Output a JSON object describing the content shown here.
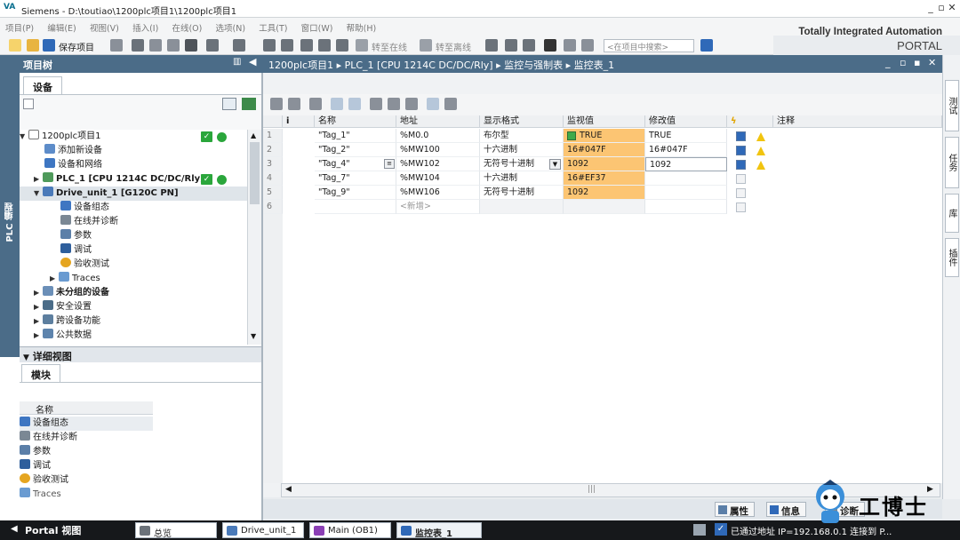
{
  "window": {
    "app": "Siemens",
    "title": "Siemens  -  D:\\toutiao\\1200plc项目1\\1200plc项目1"
  },
  "menu": [
    "项目(P)",
    "编辑(E)",
    "视图(V)",
    "插入(I)",
    "在线(O)",
    "选项(N)",
    "工具(T)",
    "窗口(W)",
    "帮助(H)"
  ],
  "brand": {
    "line1": "Totally Integrated Automation",
    "line2": "PORTAL"
  },
  "toolbar": {
    "save_label": "保存项目",
    "go_online": "转至在线",
    "go_offline": "转至离线",
    "search_placeholder": "<在项目中搜索>"
  },
  "project_tree": {
    "header": "项目树",
    "side_label": "PLC 编程",
    "devices_tab": "设备",
    "items": [
      {
        "label": "1200plc项目1",
        "bold": false
      },
      {
        "label": "添加新设备"
      },
      {
        "label": "设备和网络"
      },
      {
        "label": "PLC_1 [CPU 1214C DC/DC/Rly]"
      },
      {
        "label": "Drive_unit_1 [G120C PN]"
      },
      {
        "label": "设备组态"
      },
      {
        "label": "在线并诊断"
      },
      {
        "label": "参数"
      },
      {
        "label": "调试"
      },
      {
        "label": "验收测试"
      },
      {
        "label": "Traces"
      },
      {
        "label": "未分组的设备"
      },
      {
        "label": "安全设置"
      },
      {
        "label": "跨设备功能"
      },
      {
        "label": "公共数据"
      }
    ]
  },
  "detail_view": {
    "header": "详细视图",
    "tab": "模块",
    "column": "名称",
    "items": [
      "设备组态",
      "在线并诊断",
      "参数",
      "调试",
      "验收测试",
      "Traces"
    ]
  },
  "breadcrumb": [
    "1200plc项目1",
    "PLC_1 [CPU 1214C DC/DC/Rly]",
    "监控与强制表",
    "监控表_1"
  ],
  "watch_table": {
    "columns": [
      "i",
      "名称",
      "地址",
      "显示格式",
      "监视值",
      "修改值",
      "",
      "注释"
    ],
    "rows": [
      {
        "n": "1",
        "name": "\"Tag_1\"",
        "addr": "%M0.0",
        "fmt": "布尔型",
        "mon": "TRUE",
        "mod": "TRUE"
      },
      {
        "n": "2",
        "name": "\"Tag_2\"",
        "addr": "%MW100",
        "fmt": "十六进制",
        "mon": "16#047F",
        "mod": "16#047F"
      },
      {
        "n": "3",
        "name": "\"Tag_4\"",
        "addr": "%MW102",
        "fmt": "无符号十进制",
        "mon": "1092",
        "mod": "1092"
      },
      {
        "n": "4",
        "name": "\"Tag_7\"",
        "addr": "%MW104",
        "fmt": "十六进制",
        "mon": "16#EF37",
        "mod": ""
      },
      {
        "n": "5",
        "name": "\"Tag_9\"",
        "addr": "%MW106",
        "fmt": "无符号十进制",
        "mon": "1092",
        "mod": ""
      },
      {
        "n": "6",
        "name": "",
        "addr": "<新增>",
        "fmt": "",
        "mon": "",
        "mod": ""
      }
    ],
    "monitor_color": "#fcc573"
  },
  "inspector_tabs": [
    "属性",
    "信息",
    "诊断"
  ],
  "right_tabs": [
    "测试",
    "任务",
    "库",
    "插件"
  ],
  "taskbar": {
    "portal": "Portal 视图",
    "tabs": [
      "总览",
      "Drive_unit_1",
      "Main (OB1)",
      "监控表_1"
    ],
    "status": "已通过地址 IP=192.168.0.1 连接到 P..."
  },
  "watermark": "工博士"
}
